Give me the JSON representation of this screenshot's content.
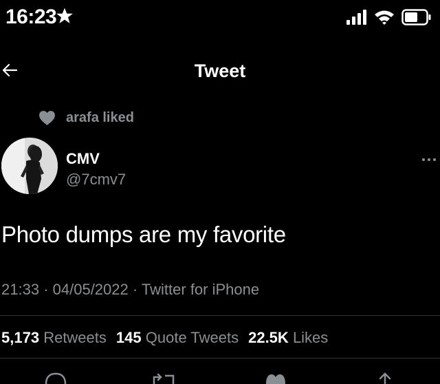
{
  "status_bar": {
    "time": "16:23",
    "icons": [
      "star-icon",
      "signal-icon",
      "wifi-icon",
      "battery-icon"
    ]
  },
  "nav": {
    "title": "Tweet",
    "back_icon": "back-arrow-icon"
  },
  "social_context": {
    "text": "arafa liked",
    "icon": "heart-icon"
  },
  "tweet": {
    "author_name": "CMV",
    "author_handle": "@7cmv7",
    "text": "Photo dumps are my favorite",
    "time": "21:33",
    "date": "04/05/2022",
    "source": "Twitter for iPhone",
    "more_icon": "more-options-icon"
  },
  "stats": {
    "retweets": "5,173",
    "retweets_label": "Retweets",
    "quote_tweets": "145",
    "quote_tweets_label": "Quote Tweets",
    "likes": "22.5K",
    "likes_label": "Likes"
  },
  "actions": [
    "reply-icon",
    "retweet-icon",
    "like-icon",
    "share-icon"
  ],
  "colors": {
    "background": "#000000",
    "text": "#ffffff",
    "secondary_text": "#8a8f93",
    "divider": "#333639"
  }
}
